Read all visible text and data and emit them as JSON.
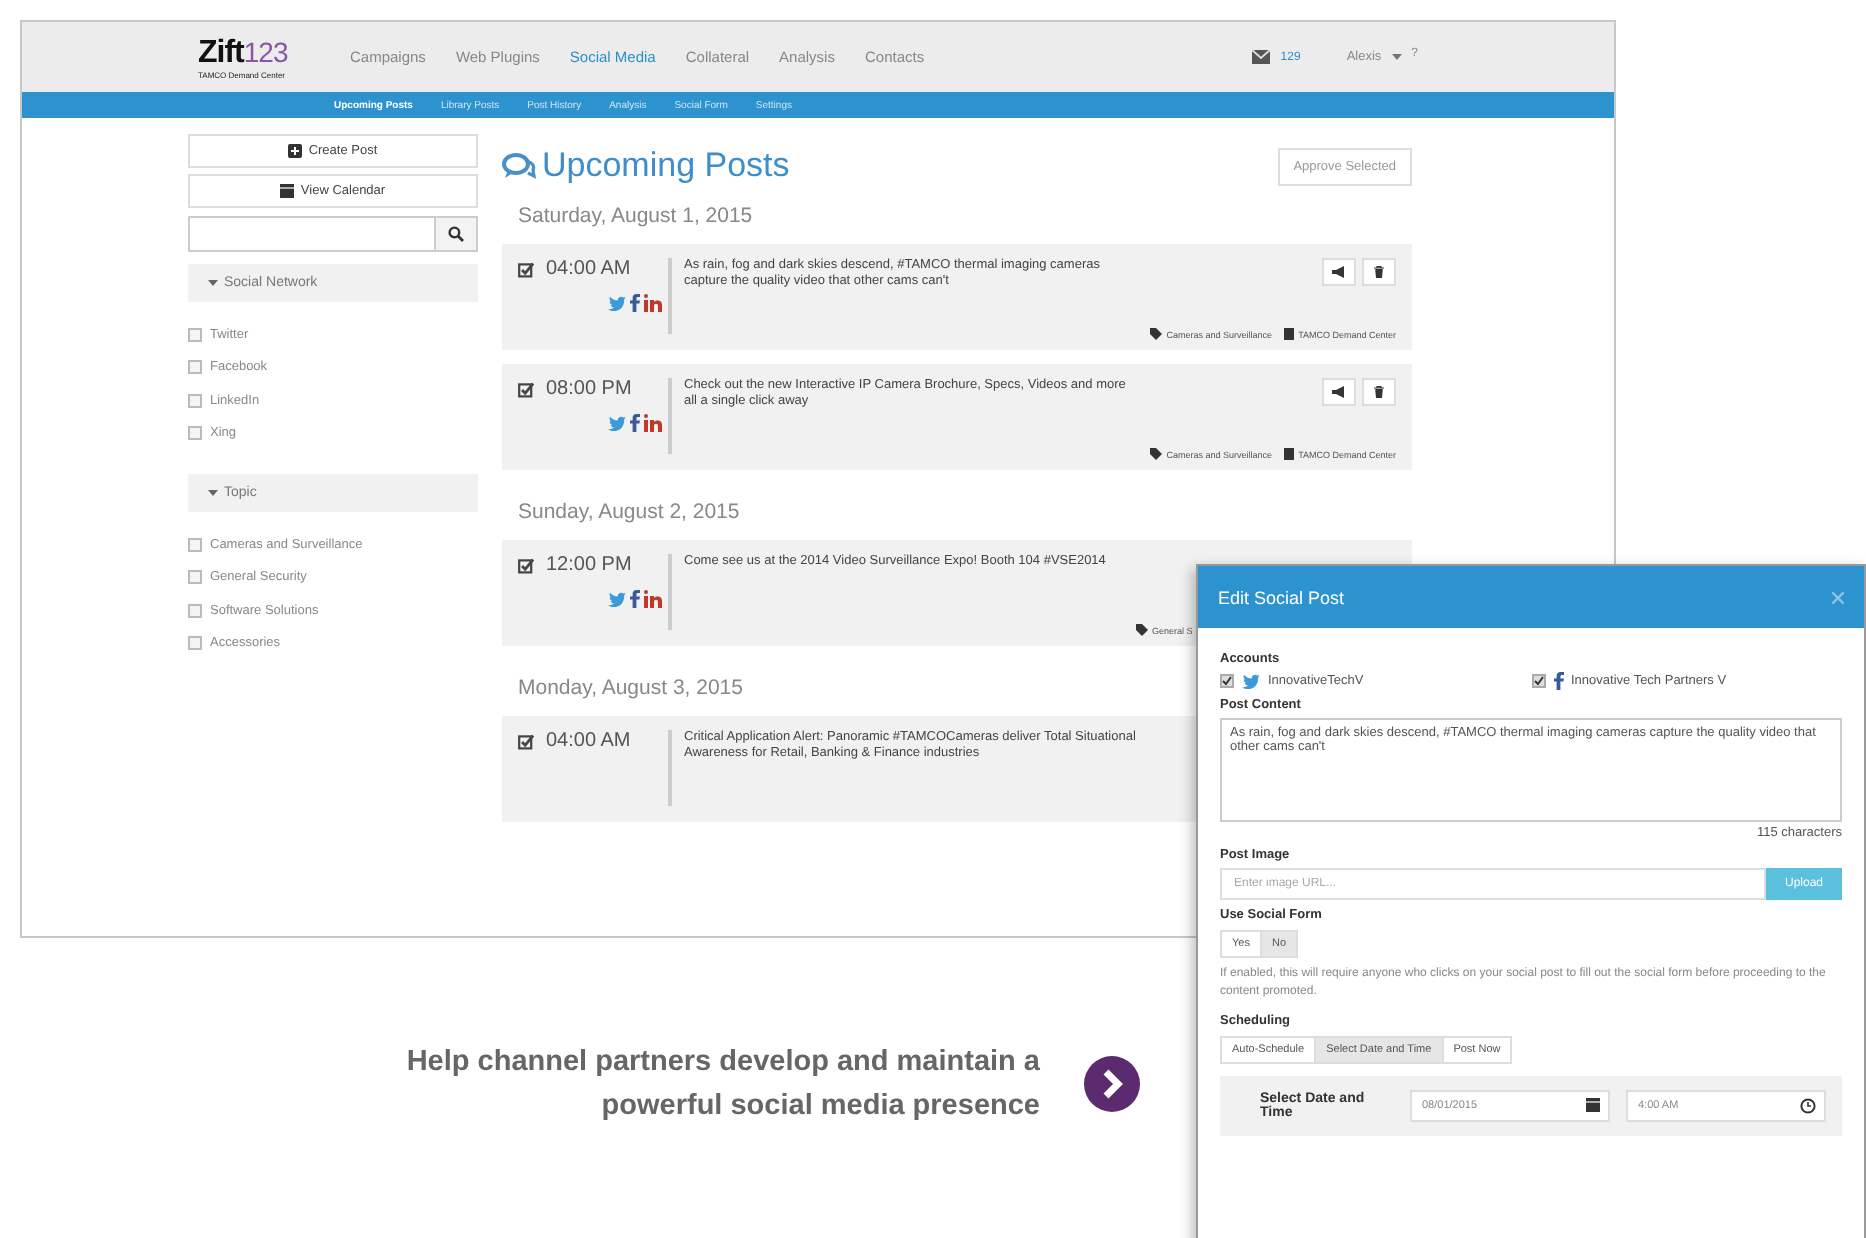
{
  "app": {
    "logo": {
      "name": "Zift",
      "number": "123",
      "tagline": "TAMCO Demand Center"
    },
    "nav": [
      {
        "label": "Campaigns",
        "selected": false
      },
      {
        "label": "Web Plugins",
        "selected": false
      },
      {
        "label": "Social Media",
        "selected": true
      },
      {
        "label": "Collateral",
        "selected": false
      },
      {
        "label": "Analysis",
        "selected": false
      },
      {
        "label": "Contacts",
        "selected": false
      }
    ],
    "messages_count": "129",
    "user": "Alexis",
    "help": "?",
    "subnav": [
      {
        "label": "Upcoming Posts",
        "selected": true
      },
      {
        "label": "Library Posts",
        "selected": false
      },
      {
        "label": "Post History",
        "selected": false
      },
      {
        "label": "Analysis",
        "selected": false
      },
      {
        "label": "Social Form",
        "selected": false
      },
      {
        "label": "Settings",
        "selected": false
      }
    ]
  },
  "sidebar": {
    "buttons": [
      {
        "kind": "create",
        "label": "Create Post"
      },
      {
        "kind": "calendar",
        "label": "View Calendar"
      }
    ],
    "filters": [
      {
        "title": "Social Network",
        "expanded": true,
        "items": [
          {
            "label": "Twitter",
            "checked": false
          },
          {
            "label": "Facebook",
            "checked": false
          },
          {
            "label": "LinkedIn",
            "checked": false
          },
          {
            "label": "Xing",
            "checked": false
          }
        ]
      },
      {
        "title": "Topic",
        "expanded": true,
        "items": [
          {
            "label": "Cameras and Surveillance",
            "checked": false
          },
          {
            "label": "General Security",
            "checked": false
          },
          {
            "label": "Software Solutions",
            "checked": false
          },
          {
            "label": "Accessories",
            "checked": false
          }
        ]
      }
    ]
  },
  "main": {
    "title": "Upcoming Posts",
    "approve_button": "Approve Selected",
    "days": [
      {
        "date": "Saturday, August 1, 2015",
        "posts": [
          {
            "checked": true,
            "time": "04:00 AM",
            "social": true,
            "actions": true,
            "text": "As rain, fog and dark skies descend, #TAMCO thermal imaging cameras capture the quality video that other cams can't",
            "tags": [
              {
                "kind": "topic",
                "label": "Cameras and Surveillance"
              },
              {
                "kind": "center",
                "label": "TAMCO Demand Center"
              }
            ]
          },
          {
            "checked": true,
            "time": "08:00 PM",
            "social": true,
            "actions": true,
            "text": "Check out the new Interactive IP Camera Brochure, Specs, Videos and more all a single click away",
            "tags": [
              {
                "kind": "topic",
                "label": "Cameras and Surveillance"
              },
              {
                "kind": "center",
                "label": "TAMCO Demand Center"
              }
            ]
          }
        ]
      },
      {
        "date": "Sunday, August 2, 2015",
        "posts": [
          {
            "checked": true,
            "time": "12:00 PM",
            "social": true,
            "actions": false,
            "text": "Come see us at the 2014 Video Surveillance Expo! Booth 104 #VSE2014",
            "tags": [
              {
                "kind": "topic",
                "label": "General S"
              }
            ]
          }
        ]
      },
      {
        "date": "Monday, August 3, 2015",
        "posts": [
          {
            "checked": true,
            "time": "04:00 AM",
            "social": false,
            "actions": false,
            "text": "Critical Application Alert: Panoramic #TAMCOCameras deliver Total Situational Awareness for Retail, Banking & Finance industries"
          }
        ]
      }
    ]
  },
  "modal": {
    "title": "Edit Social Post",
    "accounts_label": "Accounts",
    "accounts": [
      {
        "kind": "twitter",
        "name": "InnovativeTechV",
        "checked": true
      },
      {
        "kind": "facebook",
        "name": "Innovative Tech Partners V",
        "checked": true
      }
    ],
    "content_label": "Post Content",
    "content": "As rain, fog and dark skies descend, #TAMCO thermal imaging cameras capture the quality video that other cams can't",
    "char_count": "115 characters",
    "image_label": "Post Image",
    "image_placeholder": "Enter image URL...",
    "upload_button": "Upload",
    "social_form_label": "Use Social Form",
    "social_form_options": [
      {
        "label": "Yes",
        "selected": false
      },
      {
        "label": "No",
        "selected": true
      }
    ],
    "social_form_help": "If enabled, this will require anyone who clicks on your social post to fill out the social form before proceeding to the content promoted.",
    "scheduling_label": "Scheduling",
    "scheduling_options": [
      {
        "label": "Auto-Schedule",
        "selected": false
      },
      {
        "label": "Select Date and Time",
        "selected": true
      },
      {
        "label": "Post Now",
        "selected": false
      }
    ],
    "date_label": "Select Date and Time",
    "date": "08/01/2015",
    "time": "4:00 AM"
  },
  "caption": {
    "text": "Help channel partners develop and maintain a powerful social media presence"
  }
}
